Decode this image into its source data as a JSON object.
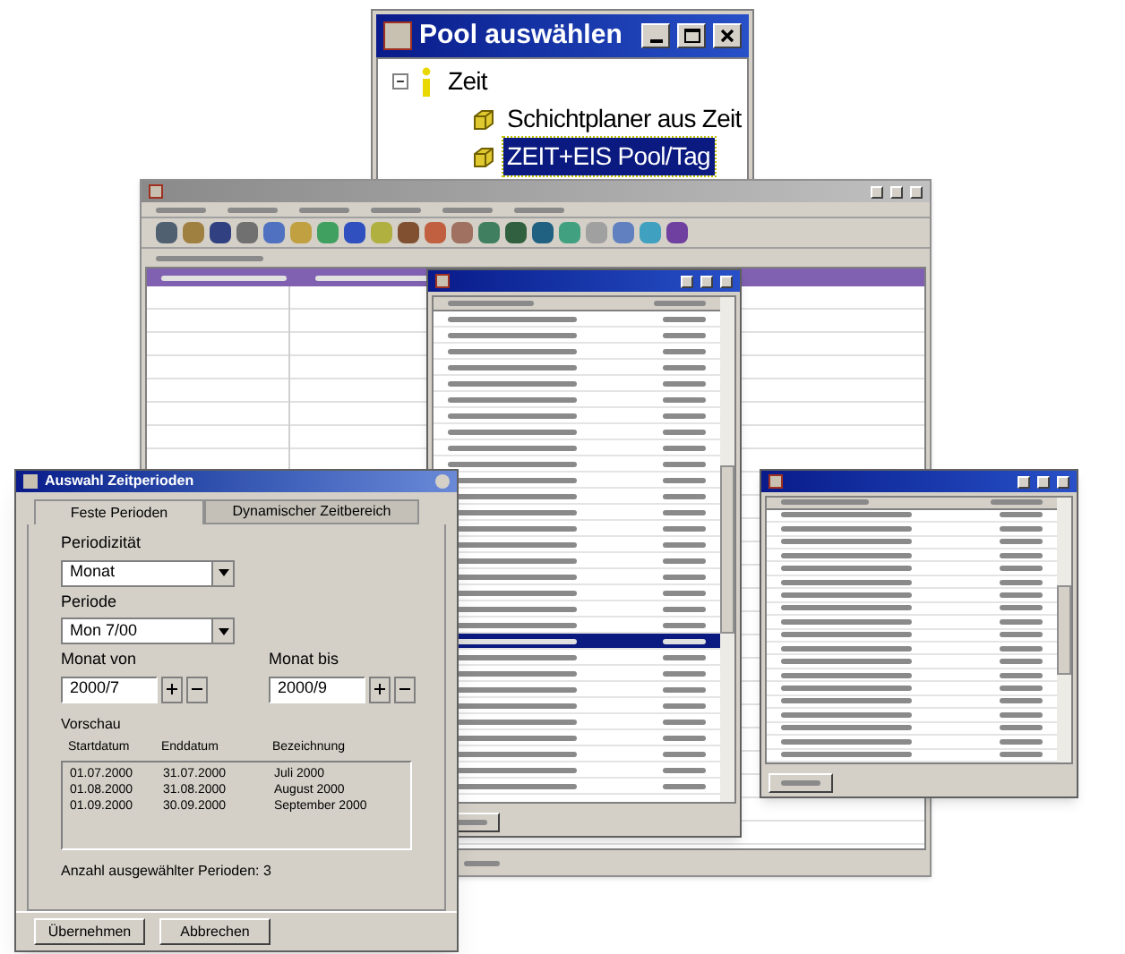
{
  "pool_window": {
    "title": "Pool auswählen",
    "tree": [
      {
        "label": "Zeit",
        "expanded": true,
        "children": [
          {
            "label": "Schichtplaner aus Zeit",
            "selected": false
          },
          {
            "label": "ZEIT+EIS Pool/Tag",
            "selected": true
          }
        ]
      }
    ]
  },
  "pool_list": {
    "rows": [
      {
        "selected": false
      },
      {
        "selected": false
      },
      {
        "selected": false
      },
      {
        "selected": false
      },
      {
        "selected": false
      },
      {
        "selected": false
      },
      {
        "selected": false
      },
      {
        "selected": false
      },
      {
        "selected": false
      },
      {
        "selected": false
      },
      {
        "selected": false
      },
      {
        "selected": false
      },
      {
        "selected": false
      },
      {
        "selected": false
      },
      {
        "selected": false
      },
      {
        "selected": false
      },
      {
        "selected": false
      },
      {
        "selected": false
      },
      {
        "selected": false
      },
      {
        "selected": false
      },
      {
        "selected": true
      },
      {
        "selected": false
      },
      {
        "selected": false
      },
      {
        "selected": false
      },
      {
        "selected": false
      },
      {
        "selected": false
      },
      {
        "selected": false
      },
      {
        "selected": false
      },
      {
        "selected": false
      },
      {
        "selected": false
      }
    ]
  },
  "dialog": {
    "title": "Auswahl Zeitperioden",
    "tabs": [
      {
        "label": "Feste Perioden",
        "selected": true
      },
      {
        "label": "Dynamischer Zeitbereich",
        "selected": false
      }
    ],
    "periodicity": {
      "label": "Periodizität",
      "value": "Monat"
    },
    "period": {
      "label": "Periode",
      "value": "Mon 7/00"
    },
    "from": {
      "label": "Monat von",
      "value": "2000/7"
    },
    "to": {
      "label": "Monat bis",
      "value": "2000/9"
    },
    "preview": {
      "label": "Vorschau",
      "columns": [
        "Startdatum",
        "Enddatum",
        "Bezeichnung"
      ],
      "rows": [
        [
          "01.07.2000",
          "31.07.2000",
          "Juli 2000"
        ],
        [
          "01.08.2000",
          "31.08.2000",
          "August 2000"
        ],
        [
          "01.09.2000",
          "30.09.2000",
          "September 2000"
        ]
      ]
    },
    "count": "Anzahl ausgewählter Perioden: 3",
    "buttons": [
      "Übernehmen",
      "Abbrechen"
    ]
  }
}
